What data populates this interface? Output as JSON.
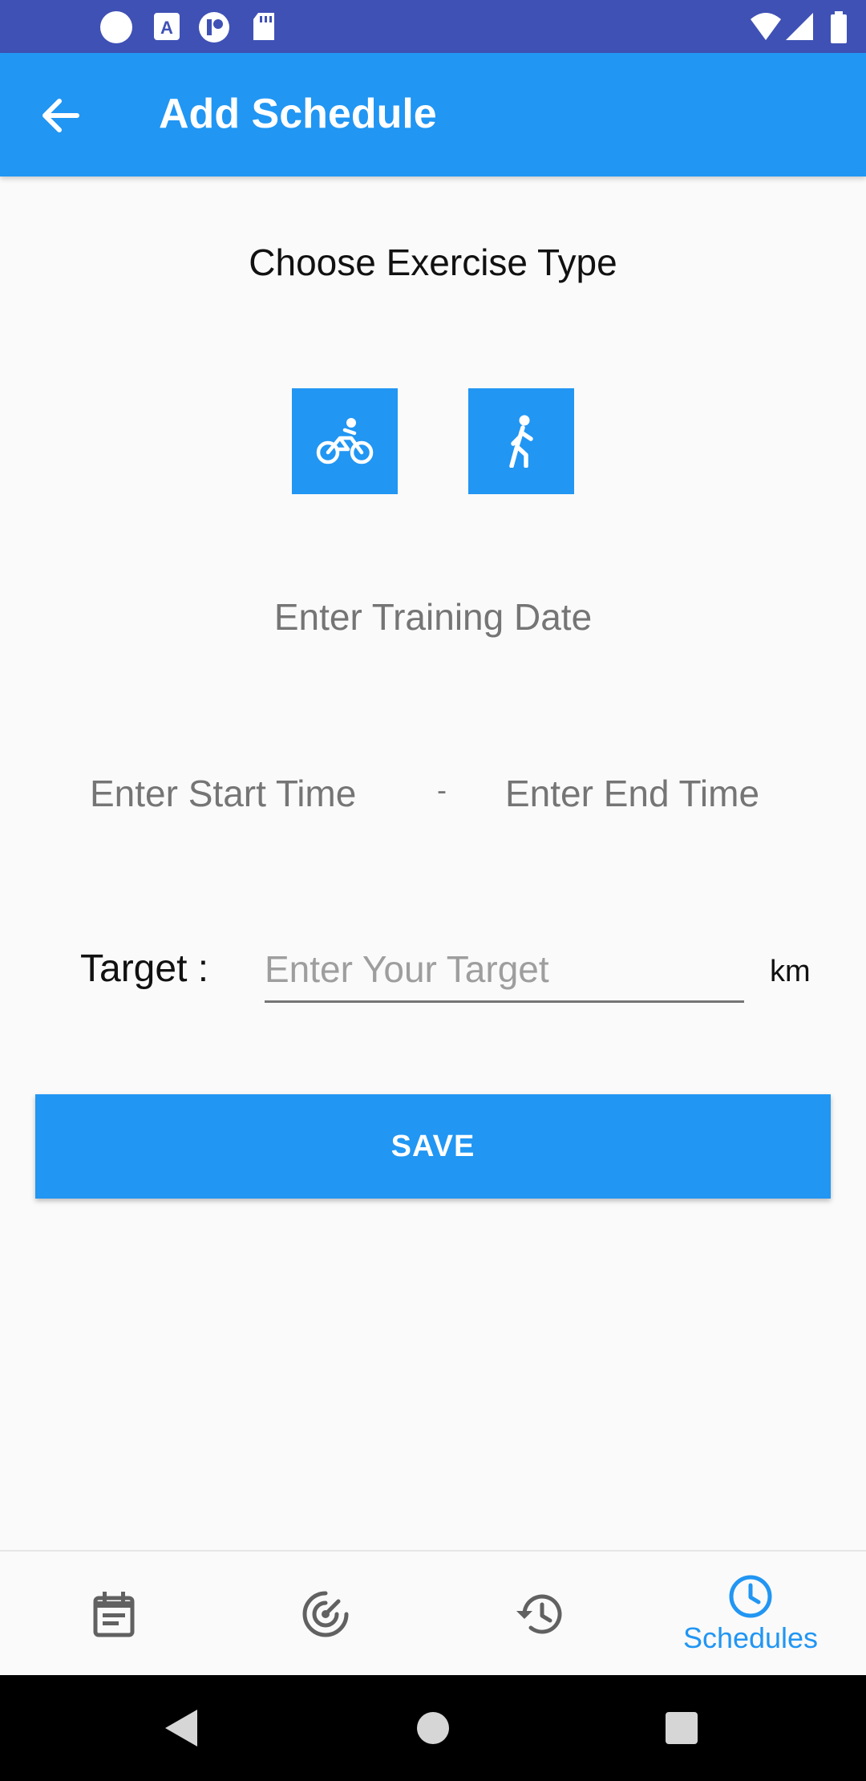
{
  "app_bar": {
    "title": "Add Schedule"
  },
  "exercise": {
    "heading": "Choose Exercise Type",
    "options": [
      "bike-icon",
      "walk-icon"
    ]
  },
  "date": {
    "placeholder": "Enter Training Date"
  },
  "time": {
    "start_placeholder": "Enter Start Time",
    "separator": "-",
    "end_placeholder": "Enter End Time"
  },
  "target": {
    "label": "Target :",
    "placeholder": "Enter Your Target",
    "unit": "km"
  },
  "save_label": "SAVE",
  "bottom_nav": {
    "items": [
      {
        "icon": "event-note-icon",
        "label": ""
      },
      {
        "icon": "radar-icon",
        "label": ""
      },
      {
        "icon": "history-icon",
        "label": ""
      },
      {
        "icon": "clock-icon",
        "label": "Schedules"
      }
    ],
    "active_index": 3
  },
  "colors": {
    "primary": "#2196f3",
    "status_bar": "#3f51b5",
    "hint_text": "#757575"
  }
}
